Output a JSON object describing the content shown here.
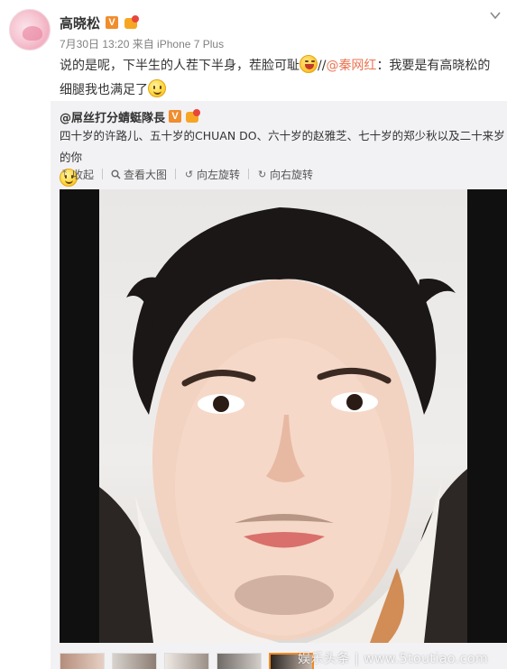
{
  "post": {
    "author": "高晓松",
    "verified_badge": "V",
    "meta": "7月30日 13:20 来自 iPhone 7 Plus",
    "text_part1": "说的是呢，下半生的人茬下半身，茬脸可耻",
    "separator": "//",
    "mention": "@秦网红",
    "text_part2": "：我要是有高晓松的细腿我也满足了"
  },
  "repost": {
    "author": "@屌丝打分蜻蜓隊長",
    "verified_badge": "V",
    "text": "四十岁的许路儿、五十岁的CHUAN DO、六十岁的赵雅芝、七十岁的郑少秋以及二十来岁的你"
  },
  "toolbar": {
    "collapse": "收起",
    "view_large": "查看大图",
    "rotate_left": "向左旋转",
    "rotate_right": "向右旋转"
  },
  "watermark": "娱乐头条 | www.5toutiao.com",
  "icons": {
    "collapse": "arrow-up-icon",
    "view_large": "search-icon",
    "rotate_left": "rotate-left-icon",
    "rotate_right": "rotate-right-icon",
    "menu": "chevron-down-icon"
  },
  "colors": {
    "link": "#eb7350",
    "verified": "#f08d2d",
    "thumb_active": "#f58a1f"
  }
}
